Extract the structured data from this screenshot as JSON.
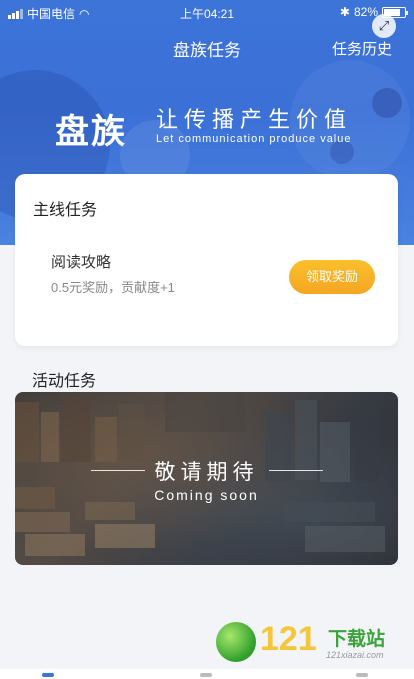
{
  "status_bar": {
    "carrier": "中国电信",
    "time": "上午04:21",
    "battery_percent": "82%",
    "battery_level": 0.82
  },
  "nav": {
    "title": "盘族任务",
    "history_label": "任务历史"
  },
  "hero": {
    "brand": "盘族",
    "slogan": "让传播产生价值",
    "slogan_en": "Let communication produce value"
  },
  "main_task": {
    "section_title": "主线任务",
    "task_name": "阅读攻略",
    "task_desc": "0.5元奖励，贡献度+1",
    "claim_label": "领取奖励"
  },
  "activity": {
    "section_title": "活动任务",
    "banner_cn": "敬请期待",
    "banner_en": "Coming soon"
  },
  "watermark": {
    "number": "121",
    "text": "下载站",
    "url": "121xiazai.com"
  },
  "colors": {
    "primary_blue": "#3d74d8",
    "accent_orange": "#f5a623"
  }
}
